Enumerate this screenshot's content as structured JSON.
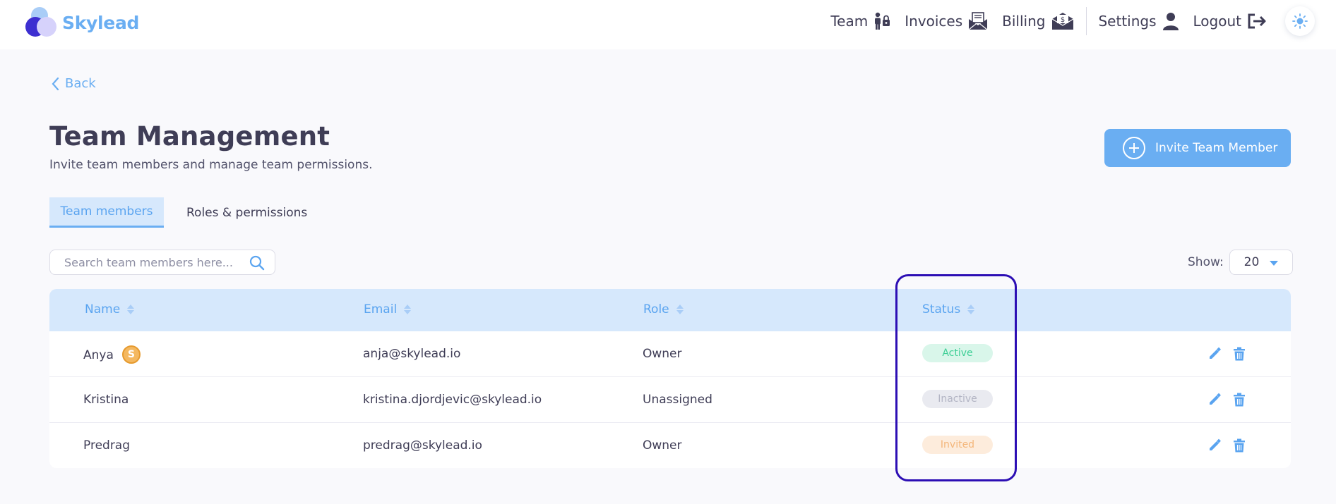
{
  "brand": {
    "name": "Skylead"
  },
  "nav": {
    "items": [
      {
        "label": "Team",
        "icon": "team-lock-icon"
      },
      {
        "label": "Invoices",
        "icon": "invoice-envelope-icon"
      },
      {
        "label": "Billing",
        "icon": "billing-envelope-icon"
      },
      {
        "label": "Settings",
        "icon": "user-icon"
      },
      {
        "label": "Logout",
        "icon": "logout-icon"
      }
    ],
    "theme_icon": "sun-icon"
  },
  "page": {
    "back_label": "Back",
    "title": "Team Management",
    "subtitle": "Invite team members and manage team permissions.",
    "invite_label": "Invite Team Member"
  },
  "tabs": [
    {
      "label": "Team members",
      "active": true
    },
    {
      "label": "Roles & permissions",
      "active": false
    }
  ],
  "search": {
    "placeholder": "Search team members here...",
    "value": ""
  },
  "show": {
    "label": "Show:",
    "value": "20"
  },
  "table": {
    "columns": [
      "Name",
      "Email",
      "Role",
      "Status"
    ],
    "rows": [
      {
        "name": "Anya",
        "owner_badge": "S",
        "email": "anja@skylead.io",
        "role": "Owner",
        "status": "Active",
        "status_color": "#3ecf96",
        "status_bg": "#d9f6ea"
      },
      {
        "name": "Kristina",
        "email": "kristina.djordjevic@skylead.io",
        "role": "Unassigned",
        "status": "Inactive",
        "status_color": "#b3b5c4",
        "status_bg": "#e9eaf0"
      },
      {
        "name": "Predrag",
        "email": "predrag@skylead.io",
        "role": "Owner",
        "status": "Invited",
        "status_color": "#f4b67a",
        "status_bg": "#fdecdc"
      }
    ]
  },
  "colors": {
    "accent": "#6aaef2",
    "highlight": "#2c0eb4",
    "text": "#3f3d56"
  }
}
